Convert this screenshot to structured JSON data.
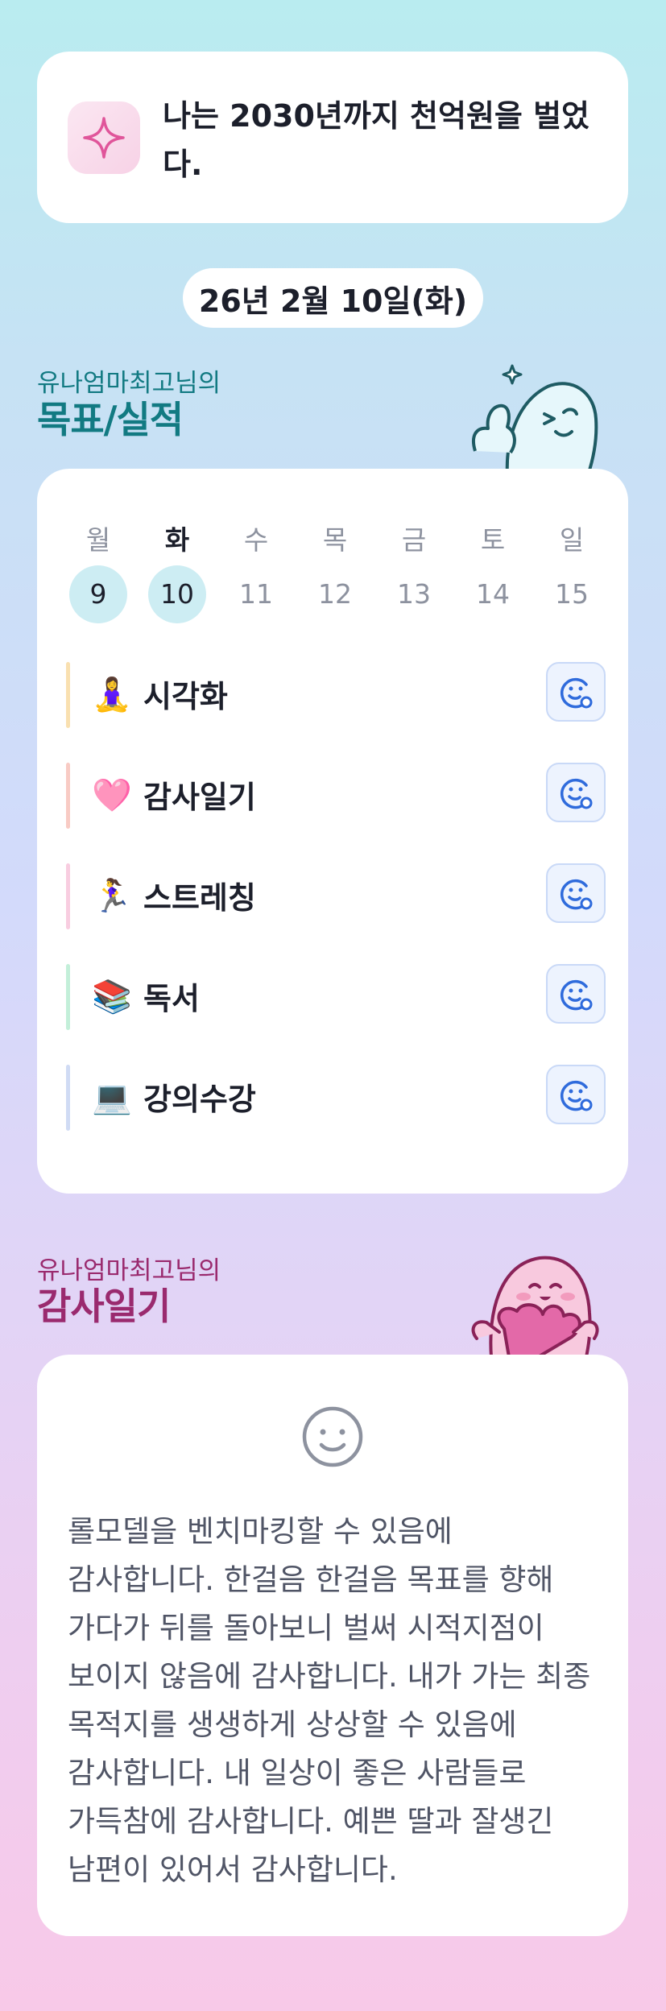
{
  "goal": {
    "text": "나는 2030년까지 천억원을 벌었다."
  },
  "date": "26년 2월 10일(화)",
  "goals_section": {
    "subtitle": "유나엄마최고님의",
    "title": "목표/실적"
  },
  "week": {
    "days": [
      {
        "label": "월",
        "date": "9",
        "done": true,
        "active": false
      },
      {
        "label": "화",
        "date": "10",
        "done": true,
        "active": true
      },
      {
        "label": "수",
        "date": "11",
        "done": false,
        "active": false
      },
      {
        "label": "목",
        "date": "12",
        "done": false,
        "active": false
      },
      {
        "label": "금",
        "date": "13",
        "done": false,
        "active": false
      },
      {
        "label": "토",
        "date": "14",
        "done": false,
        "active": false
      },
      {
        "label": "일",
        "date": "15",
        "done": false,
        "active": false
      }
    ]
  },
  "habits": [
    {
      "emoji": "🧘‍♀️",
      "label": "시각화",
      "bar_color": "#f9e0b0"
    },
    {
      "emoji": "🩷",
      "label": "감사일기",
      "bar_color": "#f8cbc4"
    },
    {
      "emoji": "🏃‍♀️",
      "label": "스트레칭",
      "bar_color": "#f8cde0"
    },
    {
      "emoji": "📚",
      "label": "독서",
      "bar_color": "#c3efd9"
    },
    {
      "emoji": "💻",
      "label": "강의수강",
      "bar_color": "#d0dbf4"
    }
  ],
  "gratitude_section": {
    "subtitle": "유나엄마최고님의",
    "title": "감사일기"
  },
  "gratitude": {
    "text": "롤모델을 벤치마킹할 수 있음에 감사합니다. 한걸음 한걸음 목표를 향해 가다가 뒤를 돌아보니 벌써 시적지점이 보이지 않음에 감사합니다. 내가 가는 최종 목적지를 생생하게 상상할 수 있음에 감사합니다. 내 일상이 좋은 사람들로 가득참에 감사합니다. 예쁜 딸과 잘생긴 남편이 있어서 감사합니다."
  },
  "colors": {
    "accent_blue": "#2f6bdc",
    "teal": "#127a82",
    "plum": "#9a2a6e"
  }
}
